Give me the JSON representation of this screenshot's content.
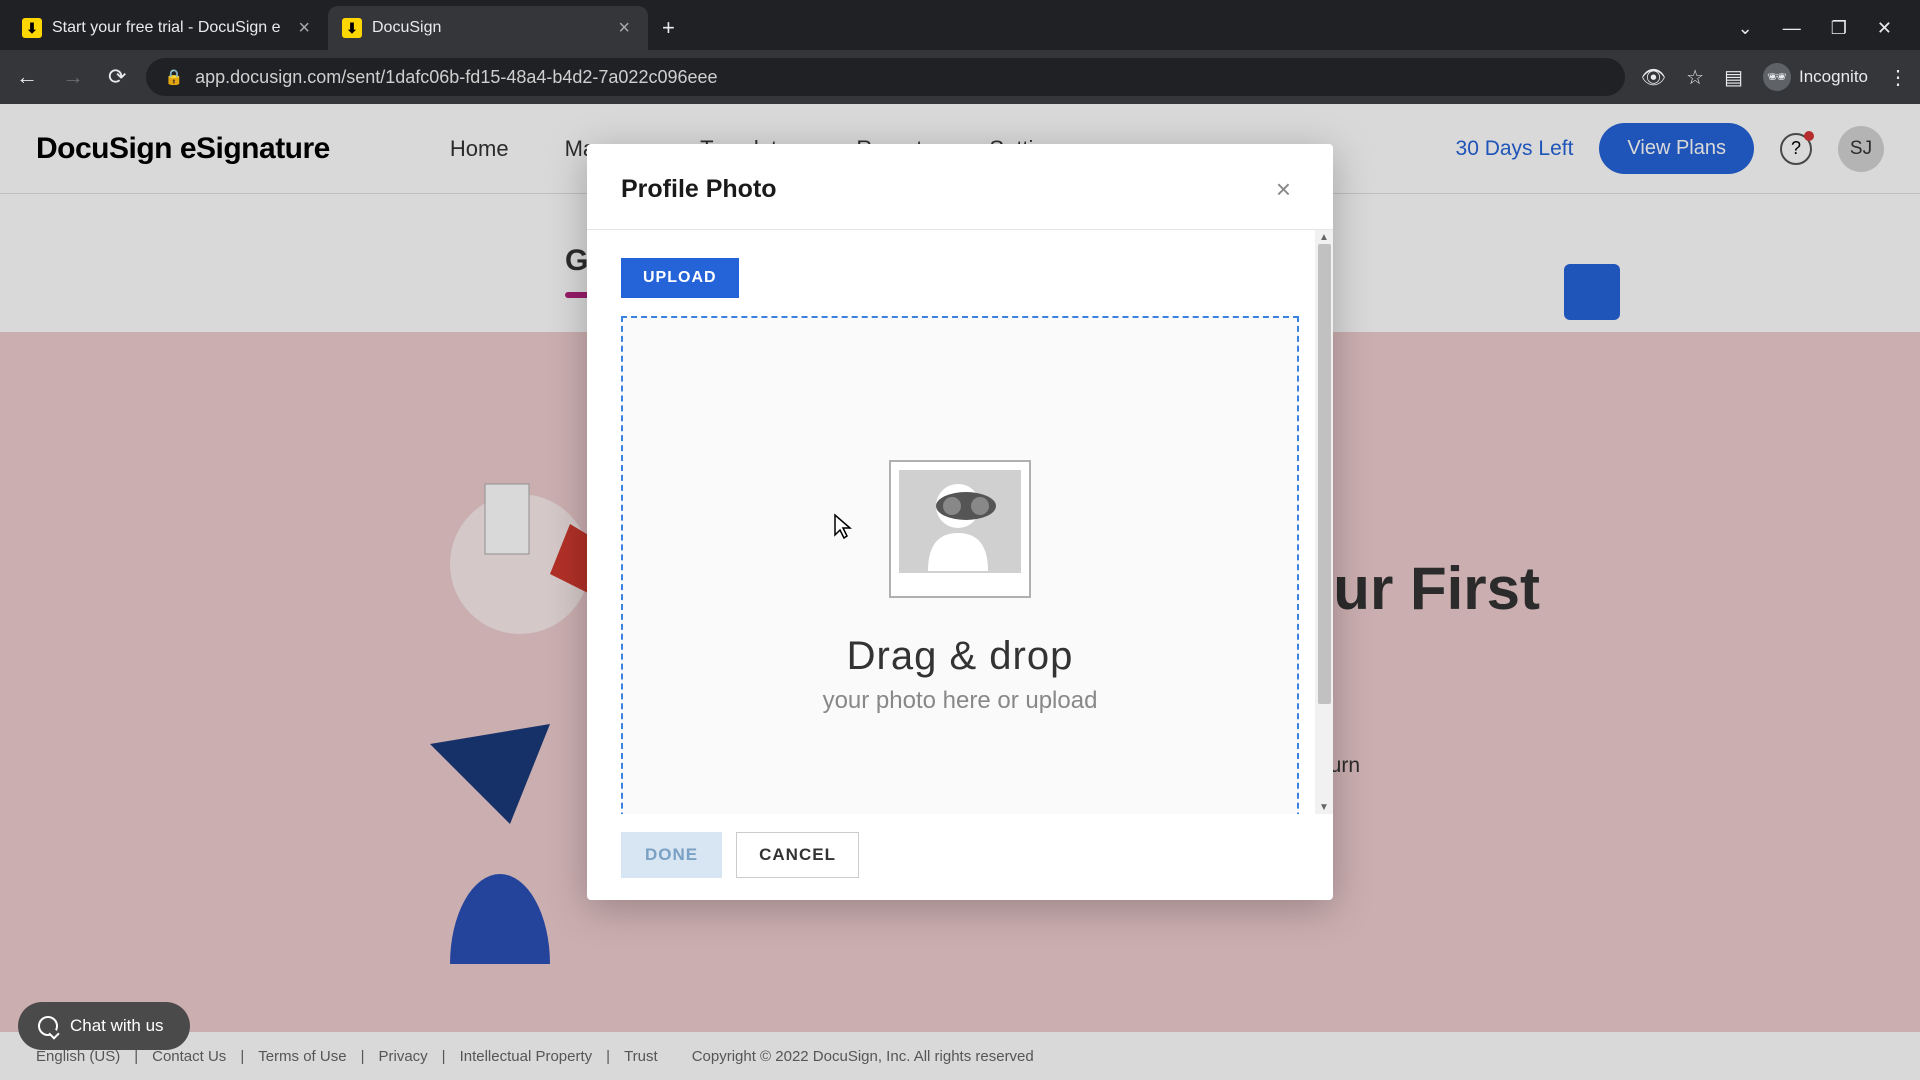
{
  "browser": {
    "tabs": [
      {
        "title": "Start your free trial - DocuSign e"
      },
      {
        "title": "DocuSign"
      }
    ],
    "url": "app.docusign.com/sent/1dafc06b-fd15-48a4-b4d2-7a022c096eee",
    "incognito_label": "Incognito"
  },
  "header": {
    "logo": "DocuSign eSignature",
    "nav": {
      "home": "Home",
      "manage": "Manage",
      "templates": "Templates",
      "reports": "Reports",
      "settings": "Settings"
    },
    "days_left": "30 Days Left",
    "view_plans": "View Plans",
    "avatar_initials": "SJ"
  },
  "background": {
    "greeting_initial": "G",
    "send_fragment": "our First",
    "turn_fragment": "r turn"
  },
  "modal": {
    "title": "Profile Photo",
    "upload_label": "UPLOAD",
    "drop_title": "Drag & drop",
    "drop_sub": "your photo here or upload",
    "done_label": "DONE",
    "cancel_label": "CANCEL"
  },
  "chat": {
    "label": "Chat with us"
  },
  "footer": {
    "lang": "English (US)",
    "links": {
      "contact": "Contact Us",
      "terms": "Terms of Use",
      "privacy": "Privacy",
      "ip": "Intellectual Property",
      "trust": "Trust"
    },
    "copyright": "Copyright © 2022 DocuSign, Inc. All rights reserved"
  }
}
